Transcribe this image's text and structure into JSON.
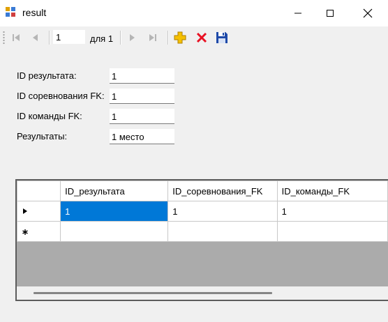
{
  "window": {
    "title": "result"
  },
  "navigator": {
    "position_value": "1",
    "count_label": "для 1"
  },
  "form": {
    "fields": [
      {
        "label": "ID результата:",
        "value": "1"
      },
      {
        "label": "ID соревнования FK:",
        "value": "1"
      },
      {
        "label": "ID команды FK:",
        "value": "1"
      },
      {
        "label": "Результаты:",
        "value": "1 место"
      }
    ]
  },
  "grid": {
    "columns": [
      "ID_результата",
      "ID_соревнования_FK",
      "ID_команды_FK"
    ],
    "rows": [
      [
        "1",
        "1",
        "1"
      ]
    ]
  },
  "colors": {
    "selection": "#0078d7",
    "add_icon": "#f5c000",
    "delete_icon": "#e81123",
    "save_icon": "#1f4aa8"
  },
  "icons": {
    "move_first": "move-first-icon",
    "move_previous": "move-previous-icon",
    "move_next": "move-next-icon",
    "move_last": "move-last-icon",
    "add": "add-new-icon",
    "delete": "delete-icon",
    "save": "save-icon"
  }
}
